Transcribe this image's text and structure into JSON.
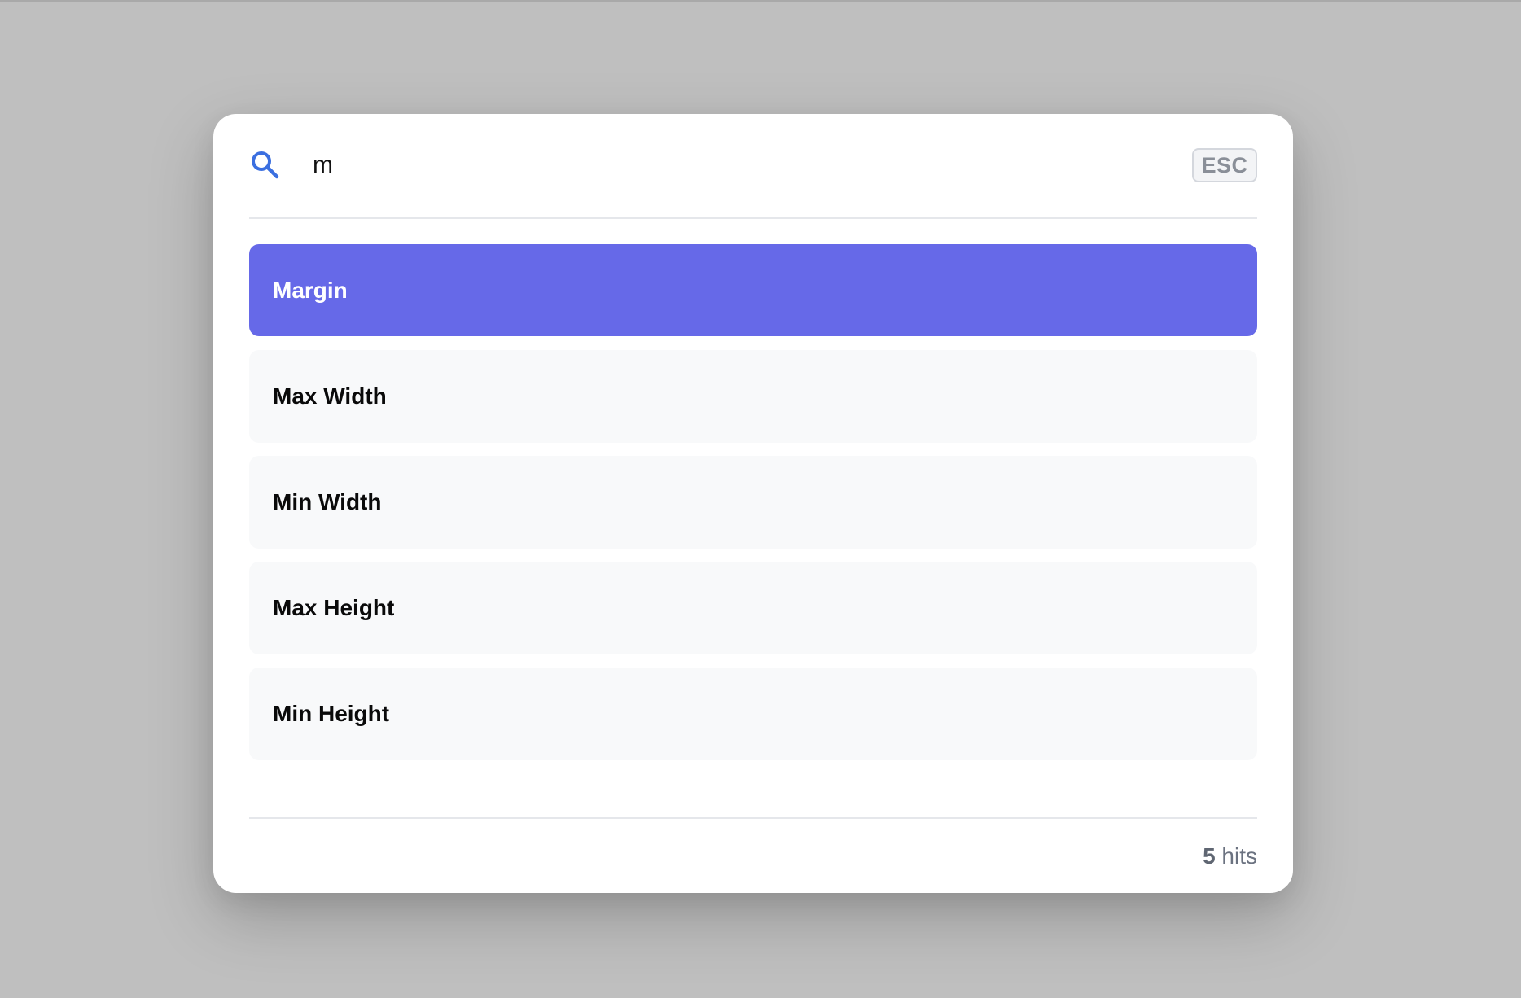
{
  "search": {
    "value": "m",
    "esc_label": "ESC"
  },
  "results": [
    {
      "label": "Margin",
      "active": true
    },
    {
      "label": "Max Width",
      "active": false
    },
    {
      "label": "Min Width",
      "active": false
    },
    {
      "label": "Max Height",
      "active": false
    },
    {
      "label": "Min Height",
      "active": false
    }
  ],
  "footer": {
    "hits_count": "5",
    "hits_label": "hits"
  },
  "colors": {
    "accent": "#6669e8",
    "search_icon": "#3b6fe0",
    "backdrop": "#bfbfbf"
  },
  "icons": {
    "search": "search-icon"
  }
}
